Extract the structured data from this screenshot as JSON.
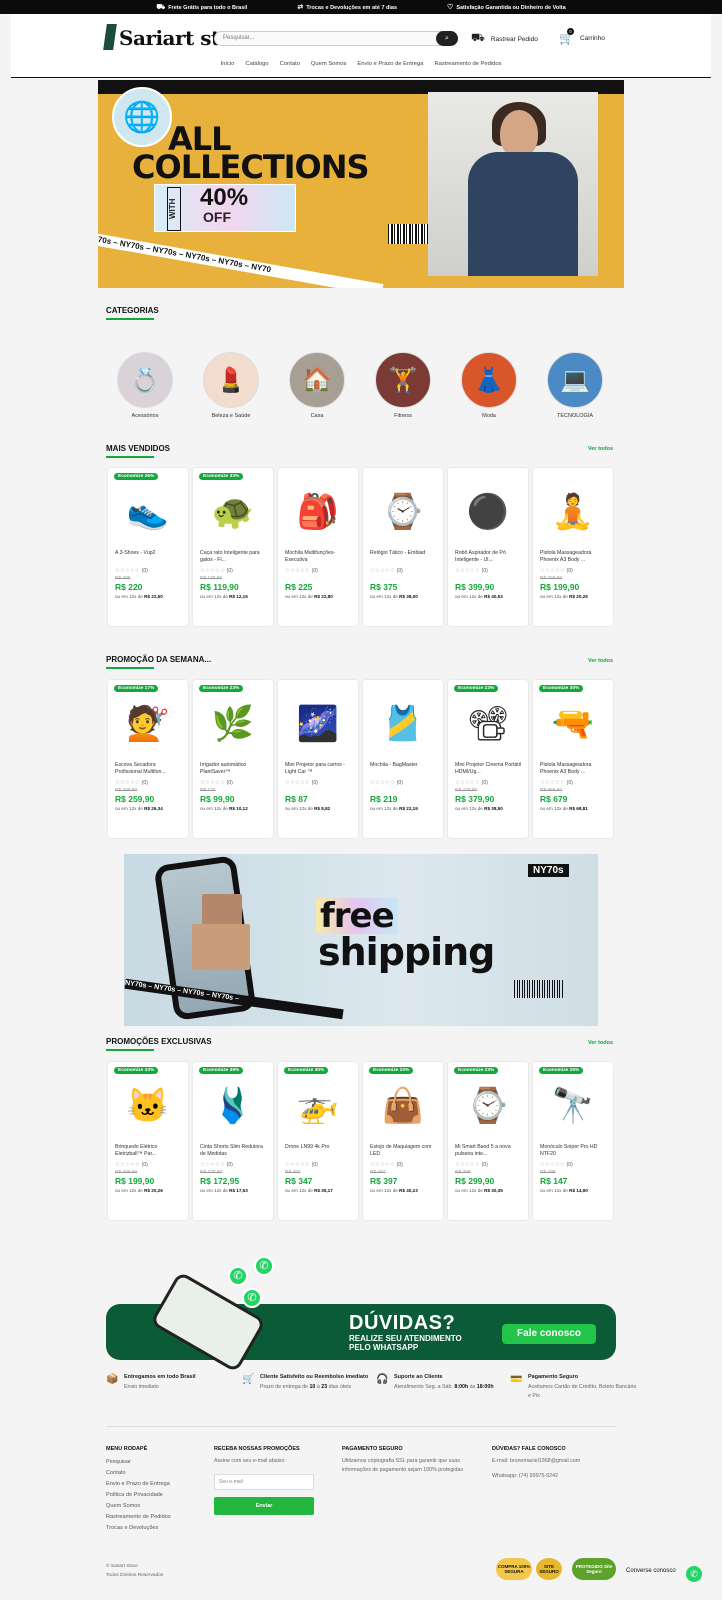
{
  "topbar": {
    "items": [
      {
        "icon": "truck-icon",
        "glyph": "⛟",
        "text": "Frete Grátis para todo o Brasil"
      },
      {
        "icon": "cart-icon",
        "glyph": "⇄",
        "text": "Trocas e Devoluções em até 7 dias"
      },
      {
        "icon": "heart-icon",
        "glyph": "♡",
        "text": "Satisfação Garantida ou Dinheiro de Volta"
      }
    ]
  },
  "header": {
    "logo": "Sariart store",
    "search_placeholder": "Pesquisar...",
    "track_label": "Rastrear Pedido",
    "cart_label": "Carrinho",
    "cart_count": "0",
    "nav": [
      "Início",
      "Catálogo",
      "Contato",
      "Quem Somos",
      "Envio e Prazo de Entrega",
      "Rastreamento de Pedidos"
    ]
  },
  "hero": {
    "line1": "ALL",
    "line2": "COLLECTIONS",
    "with": "WITH",
    "percent": "40%",
    "off": "OFF",
    "tape": "NY70s – NY70s – NY70s – NY70s – NY70s – NY70"
  },
  "categories": {
    "title": "CATEGORIAS",
    "items": [
      {
        "label": "Acessórios",
        "glyph": "💍",
        "bg": "#d9d2d8"
      },
      {
        "label": "Beleza e Saúde",
        "glyph": "💄",
        "bg": "#f1dccd"
      },
      {
        "label": "Casa",
        "glyph": "🏠",
        "bg": "#a79f93"
      },
      {
        "label": "Fitness",
        "glyph": "🏋",
        "bg": "#7b3a34"
      },
      {
        "label": "Moda",
        "glyph": "👗",
        "bg": "#d9562b"
      },
      {
        "label": "TECNOLOGIA",
        "glyph": "💻",
        "bg": "#4b8ac4"
      }
    ]
  },
  "bestsellers": {
    "title": "MAIS VENDIDOS",
    "see_all": "Ver todos",
    "products": [
      {
        "badge": "Economize 26%",
        "glyph": "👟",
        "name": "A 3-Shoes - Vup2",
        "reviews": "(0)",
        "old": "R$ 299",
        "price": "R$ 220",
        "inst_pre": "ou em 12x de",
        "inst_val": "R$ 22,50"
      },
      {
        "badge": "Economize 33%",
        "glyph": "🐢",
        "name": "Caça rato Inteligente para gatos - Fl...",
        "reviews": "(0)",
        "old": "R$ 179,90",
        "price": "R$ 119,90",
        "inst_pre": "ou em 12x de",
        "inst_val": "R$ 12,15"
      },
      {
        "badge": "",
        "glyph": "🎒",
        "name": "Mochila Multifunções-Executiva",
        "reviews": "(0)",
        "old": "",
        "price": "R$ 225",
        "inst_pre": "ou em 12x de",
        "inst_val": "R$ 22,80"
      },
      {
        "badge": "",
        "glyph": "⌚",
        "name": "Relógio Tático - Emblad",
        "reviews": "(0)",
        "old": "",
        "price": "R$ 375",
        "inst_pre": "ou em 12x de",
        "inst_val": "R$ 38,00"
      },
      {
        "badge": "",
        "glyph": "⚫",
        "name": "Robô Aspirador de Pó Inteligente - Ul...",
        "reviews": "(0)",
        "old": "",
        "price": "R$ 399,90",
        "inst_pre": "ou em 12x de",
        "inst_val": "R$ 40,53"
      },
      {
        "badge": "",
        "glyph": "🧘",
        "name": "Pistola Massageadora Phoenix A3 Body ...",
        "reviews": "(0)",
        "old": "R$ 259,90",
        "price": "R$ 199,90",
        "inst_pre": "ou em 12x de",
        "inst_val": "R$ 20,26"
      }
    ]
  },
  "weekly": {
    "title": "PROMOÇÃO DA SEMANA...",
    "see_all": "Ver todos",
    "products": [
      {
        "badge": "Economize 17%",
        "glyph": "💇",
        "name": "Escova Secadora Profissional Multifun...",
        "reviews": "(0)",
        "old": "R$ 299,90",
        "price": "R$ 259,90",
        "inst_pre": "ou em 12x de",
        "inst_val": "R$ 26,34"
      },
      {
        "badge": "Economize 23%",
        "glyph": "🌿",
        "name": "Irrigador automático PlantSaver™",
        "reviews": "(0)",
        "old": "R$ 129",
        "price": "R$ 99,90",
        "inst_pre": "ou em 12x de",
        "inst_val": "R$ 10,12"
      },
      {
        "badge": "",
        "glyph": "🌌",
        "name": "Mini Projetor para carros - Light Car ™",
        "reviews": "(0)",
        "old": "",
        "price": "R$ 87",
        "inst_pre": "ou em 12x de",
        "inst_val": "R$ 8,82"
      },
      {
        "badge": "",
        "glyph": "🎽",
        "name": "Mochila - BagMaster",
        "reviews": "(0)",
        "old": "",
        "price": "R$ 219",
        "inst_pre": "ou em 12x de",
        "inst_val": "R$ 22,19"
      },
      {
        "badge": "Economize 23%",
        "glyph": "📽",
        "name": "Mini Projetor Cinema Portátil HDMI/Ug...",
        "reviews": "(0)",
        "old": "R$ 479,90",
        "price": "R$ 379,90",
        "inst_pre": "ou em 12x de",
        "inst_val": "R$ 38,50"
      },
      {
        "badge": "Economize 30%",
        "glyph": "🔫",
        "name": "Pistola Massageadora Phoenix A3 Body ...",
        "reviews": "(0)",
        "old": "R$ 969,90",
        "price": "R$ 679",
        "inst_pre": "ou em 12x de",
        "inst_val": "R$ 68,81"
      }
    ]
  },
  "shipping_banner": {
    "word1": "free",
    "word2": "shipping",
    "tag": "NY70s",
    "tape": "NY70s – NY70s – NY70s – NY70s –"
  },
  "exclusive": {
    "title": "PROMOÇÕES EXCLUSIVAS",
    "see_all": "Ver todos",
    "products": [
      {
        "badge": "Economize 33%",
        "glyph": "🐱",
        "name": "Brinquedo Elétrico Eletrizball™ Par...",
        "reviews": "(0)",
        "old": "R$ 299,90",
        "price": "R$ 199,90",
        "inst_pre": "ou em 12x de",
        "inst_val": "R$ 20,26"
      },
      {
        "badge": "Economize 38%",
        "glyph": "🩱",
        "name": "Cinta Shorts Slim Redutora de Medidas",
        "reviews": "(0)",
        "old": "R$ 279,90",
        "price": "R$ 172,95",
        "inst_pre": "ou em 12x de",
        "inst_val": "R$ 17,53"
      },
      {
        "badge": "Economize 30%",
        "glyph": "🚁",
        "name": "Drone LN99 4k Pro",
        "reviews": "(0)",
        "old": "R$ 497",
        "price": "R$ 347",
        "inst_pre": "ou em 12x de",
        "inst_val": "R$ 35,17"
      },
      {
        "badge": "Economize 20%",
        "glyph": "👜",
        "name": "Estojo de Maquiagem com LED",
        "reviews": "(0)",
        "old": "R$ 497",
        "price": "R$ 397",
        "inst_pre": "ou em 12x de",
        "inst_val": "R$ 40,23"
      },
      {
        "badge": "Economize 23%",
        "glyph": "⌚",
        "name": "Mi Smart Band 5 a nova pulseira inte...",
        "reviews": "(0)",
        "old": "R$ 389",
        "price": "R$ 299,90",
        "inst_pre": "ou em 12x de",
        "inst_val": "R$ 30,39"
      },
      {
        "badge": "Economize 26%",
        "glyph": "🔭",
        "name": "Monóculo Sniper Pro HD NTF20",
        "reviews": "(0)",
        "old": "R$ 199",
        "price": "R$ 147",
        "inst_pre": "ou em 12x de",
        "inst_val": "R$ 14,90"
      }
    ]
  },
  "whatsapp_banner": {
    "question": "DÚVIDAS?",
    "sub": "REALIZE SEU ATENDIMENTO PELO WHATSAPP",
    "cta": "Fale conosco"
  },
  "features": [
    {
      "icon": "box-icon",
      "glyph": "📦",
      "title": "Entregamos em todo Brasil",
      "desc_pre": "Envio imediato",
      "desc_b1": "",
      "desc_mid": "",
      "desc_b2": "",
      "desc_post": ""
    },
    {
      "icon": "cart-check-icon",
      "glyph": "🛒",
      "title": "Cliente Satisfeito ou Reembolso imediato",
      "desc_pre": "Prazo de entrega de ",
      "desc_b1": "10",
      "desc_mid": " à ",
      "desc_b2": "23",
      "desc_post": " dias úteis"
    },
    {
      "icon": "support-icon",
      "glyph": "🎧",
      "title": "Suporte ao Cliente",
      "desc_pre": "Atendimento Seg. a Sáb. ",
      "desc_b1": "8:00h",
      "desc_mid": " às ",
      "desc_b2": "18:00h",
      "desc_post": ""
    },
    {
      "icon": "card-icon",
      "glyph": "💳",
      "title": "Pagamento Seguro",
      "desc_pre": "Aceitamos Cartão de Crédito, Boleto Bancário e Pix",
      "desc_b1": "",
      "desc_mid": "",
      "desc_b2": "",
      "desc_post": ""
    }
  ],
  "footer": {
    "menu_title": "MENU RODAPÉ",
    "menu": [
      "Pesquisar",
      "Contato",
      "Envio e Prazo de Entrega",
      "Política de Privacidade",
      "Quem Somos",
      "Rastreamento de Pedidos",
      "Trocas e Devoluções"
    ],
    "newsletter_title": "RECEBA NOSSAS PROMOÇÕES",
    "newsletter_text": "Assine com seu e-mail abaixo:",
    "email_placeholder": "Seu e-mail",
    "send": "Enviar",
    "payment_title": "PAGAMENTO SEGURO",
    "payment_text": "Utilizamos criptografia SSL para garantir que suas informações de pagamento sejam 100% protegidas",
    "contact_title": "DÚVIDAS? FALE CONOSCO",
    "email": "E-mail: brunomaciel1368@gmail.com",
    "whatsapp": "Whatsapp: (74) 99975-9242",
    "copy1": "© Sariart Store",
    "copy2": "Todos Direitos Reservados",
    "seals": [
      "COMPRA 100% SEGURA",
      "SITE SEGURO",
      "PROTEGIDO Site Seguro"
    ],
    "chat": "Converse conosco"
  }
}
